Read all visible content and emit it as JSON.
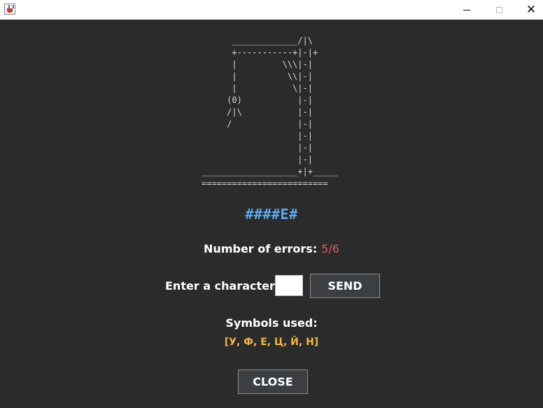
{
  "window": {
    "icon": "java-app-icon",
    "minimize_glyph": "",
    "close_glyph": "✕"
  },
  "game": {
    "gallows_ascii": "      _____________/|\\\n      +-----------+|-|+\n      |         \\\\\\|-|\n      |          \\\\|-|\n      |           \\|-|\n     (0)           |-|\n     /|\\           |-|\n     /             |-|\n                   |-|\n                   |-|\n                   |-|\n___________________+|+_____\n=========================",
    "masked_word": "####E#",
    "errors_label": "Number of errors:",
    "errors_value": "5/6",
    "enter_label": "Enter a character:",
    "input_value": "",
    "send_label": "SEND",
    "symbols_label": "Symbols used:",
    "symbols_used": "[У, Ф, Е, Ц, Й, Н]",
    "close_label": "CLOSE"
  },
  "colors": {
    "background": "#2b2b2b",
    "word": "#5aa9f0",
    "errors": "#e05a5a",
    "symbols": "#f0b64a"
  }
}
